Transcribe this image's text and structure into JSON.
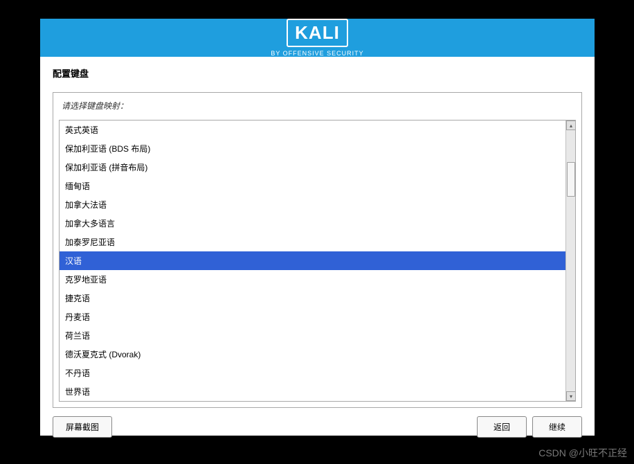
{
  "logo": {
    "title": "KALI",
    "subtitle": "BY OFFENSIVE SECURITY"
  },
  "page": {
    "title": "配置键盘",
    "prompt": "请选择键盘映射："
  },
  "keyboard_list": {
    "selected_index": 7,
    "items": [
      "英式英语",
      "保加利亚语 (BDS 布局)",
      "保加利亚语 (拼音布局)",
      "缅甸语",
      "加拿大法语",
      "加拿大多语言",
      "加泰罗尼亚语",
      "汉语",
      "克罗地亚语",
      "捷克语",
      "丹麦语",
      "荷兰语",
      "德沃夏克式 (Dvorak)",
      "不丹语",
      "世界语"
    ]
  },
  "buttons": {
    "screenshot": "屏幕截图",
    "back": "返回",
    "continue": "继续"
  },
  "watermark": "CSDN @小旺不正经"
}
